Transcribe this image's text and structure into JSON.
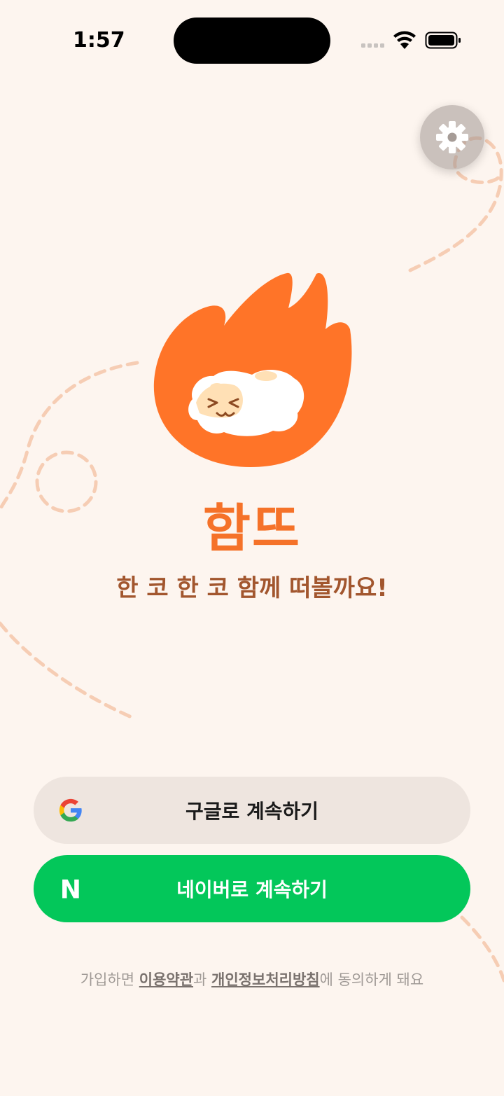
{
  "status_bar": {
    "time": "1:57"
  },
  "settings": {
    "icon": "gear-icon"
  },
  "app": {
    "name": "함뜨",
    "tagline": "한 코 한 코 함께 떠볼까요!"
  },
  "login": {
    "google_label": "구글로 계속하기",
    "naver_label": "네이버로 계속하기",
    "naver_logo_text": "N"
  },
  "terms": {
    "prefix": "가입하면 ",
    "terms_link": "이용약관",
    "conj": "과 ",
    "privacy_link": "개인정보처리방침",
    "suffix": "에 동의하게 돼요"
  },
  "colors": {
    "background": "#FDF5EF",
    "brand_orange": "#F57229",
    "tagline_brown": "#A2562E",
    "google_button": "#EEE5DF",
    "naver_green": "#03C75A"
  }
}
